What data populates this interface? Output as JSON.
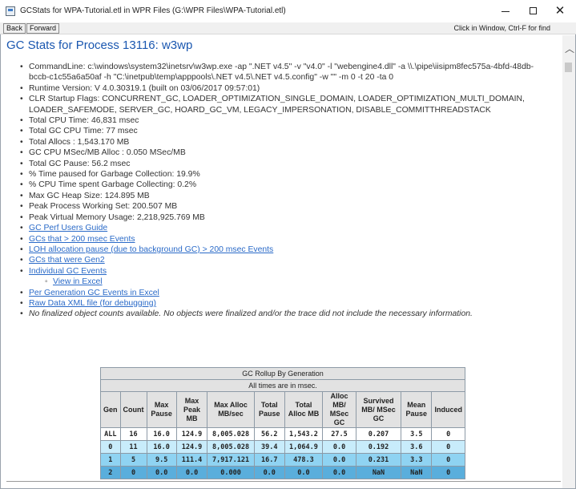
{
  "window": {
    "title": "GCStats for WPA-Tutorial.etl in WPR Files (G:\\WPR Files\\WPA-Tutorial.etl)",
    "minimize": "–",
    "maximize": "□",
    "close": "✕"
  },
  "toolbar": {
    "back_label": "Back",
    "forward_label": "Forward",
    "hint": "Click in Window, Ctrl-F for find"
  },
  "page": {
    "title": "GC Stats for Process 13116: w3wp",
    "items": [
      "CommandLine: c:\\windows\\system32\\inetsrv\\w3wp.exe -ap \".NET v4.5\" -v \"v4.0\" -l \"webengine4.dll\" -a \\\\.\\pipe\\iisipm8fec575a-4bfd-48db-bccb-c1c55a6a50af -h \"C:\\inetpub\\temp\\apppools\\.NET v4.5\\.NET v4.5.config\" -w \"\" -m 0 -t 20 -ta 0",
      "Runtime Version: V 4.0.30319.1 (built on 03/06/2017 09:57:01)",
      "CLR Startup Flags: CONCURRENT_GC, LOADER_OPTIMIZATION_SINGLE_DOMAIN, LOADER_OPTIMIZATION_MULTI_DOMAIN, LOADER_SAFEMODE, SERVER_GC, HOARD_GC_VM, LEGACY_IMPERSONATION, DISABLE_COMMITTHREADSTACK",
      "Total CPU Time: 46,831 msec",
      "Total GC CPU Time: 77 msec",
      "Total Allocs : 1,543.170 MB",
      "GC CPU MSec/MB Alloc : 0.050 MSec/MB",
      "Total GC Pause: 56.2 msec",
      "% Time paused for Garbage Collection: 19.9%",
      "% CPU Time spent Garbage Collecting: 0.2%",
      "Max GC Heap Size: 124.895 MB",
      "Peak Process Working Set: 200.507 MB",
      "Peak Virtual Memory Usage: 2,218,925.769 MB"
    ],
    "links": [
      "GC Perf Users Guide",
      "GCs that > 200 msec Events",
      "LOH allocation pause (due to background GC) > 200 msec Events",
      "GCs that were Gen2",
      "Individual GC Events"
    ],
    "sublink": "View in Excel",
    "links2": [
      "Per Generation GC Events in Excel",
      "Raw Data XML file (for debugging)"
    ],
    "note": "No finalized object counts available. No objects were finalized and/or the trace did not include the necessary information."
  },
  "table": {
    "caption": "GC Rollup By Generation",
    "subcaption": "All times are in msec.",
    "headers": [
      "Gen",
      "Count",
      "Max Pause",
      "Max Peak MB",
      "Max Alloc MB/sec",
      "Total Pause",
      "Total Alloc MB",
      "Alloc MB/ MSec GC",
      "Survived MB/ MSec GC",
      "Mean Pause",
      "Induced"
    ],
    "rows": [
      [
        "ALL",
        "16",
        "16.0",
        "124.9",
        "8,005.028",
        "56.2",
        "1,543.2",
        "27.5",
        "0.207",
        "3.5",
        "0"
      ],
      [
        "0",
        "11",
        "16.0",
        "124.9",
        "8,005.028",
        "39.4",
        "1,064.9",
        "0.0",
        "0.192",
        "3.6",
        "0"
      ],
      [
        "1",
        "5",
        "9.5",
        "111.4",
        "7,917.121",
        "16.7",
        "478.3",
        "0.0",
        "0.231",
        "3.3",
        "0"
      ],
      [
        "2",
        "0",
        "0.0",
        "0.0",
        "0.000",
        "0.0",
        "0.0",
        "0.0",
        "NaN",
        "NaN",
        "0"
      ]
    ]
  }
}
